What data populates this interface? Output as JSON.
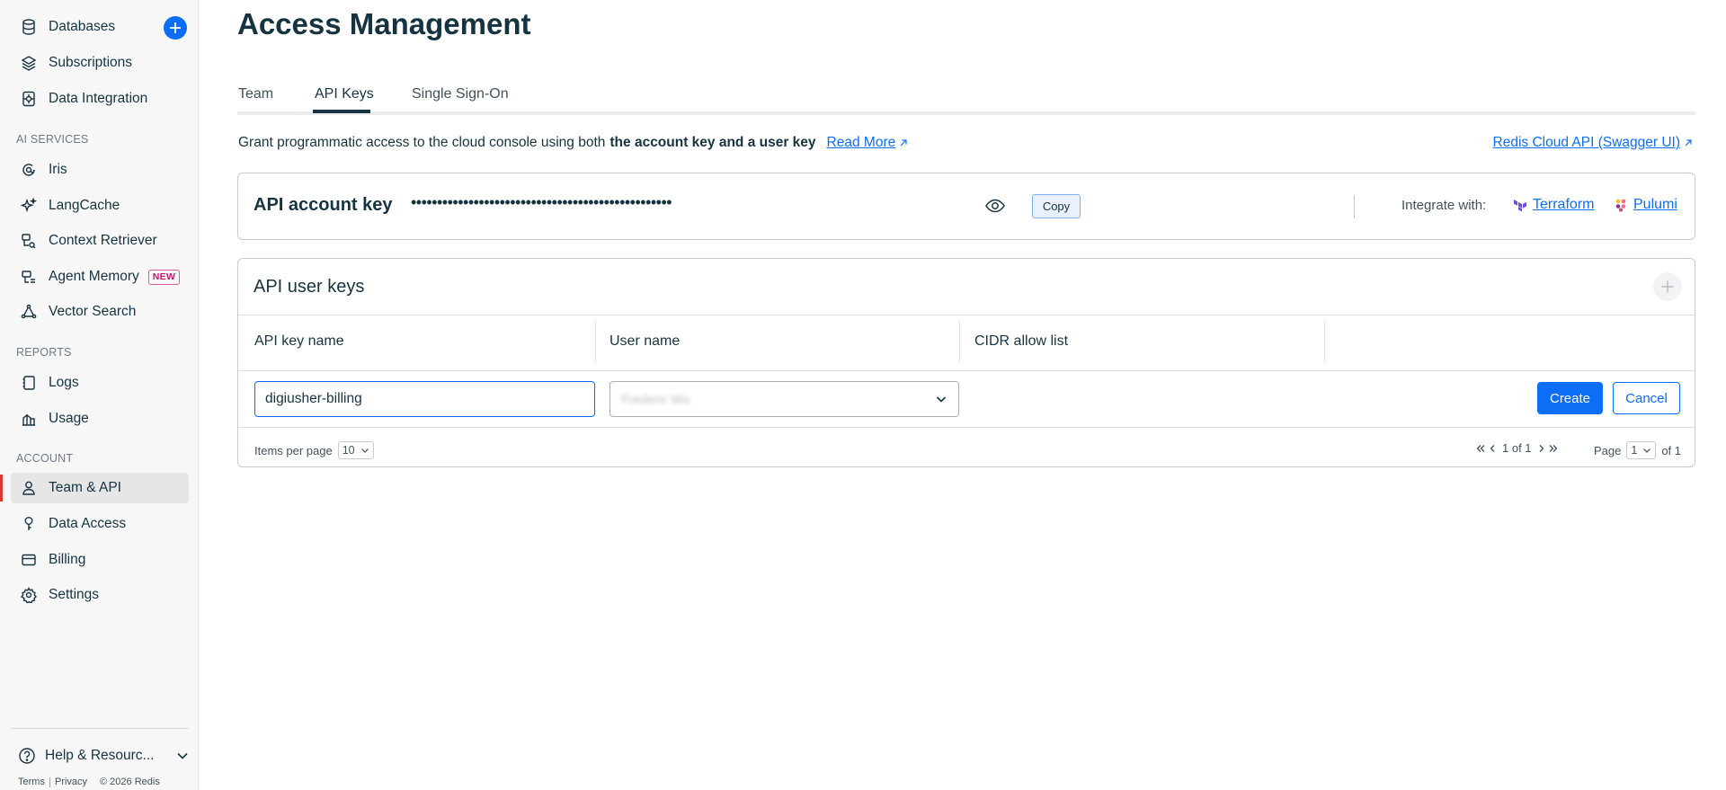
{
  "sidebar": {
    "items": [
      {
        "label": "Databases",
        "icon": "database-icon"
      },
      {
        "label": "Subscriptions",
        "icon": "layers-icon"
      },
      {
        "label": "Data Integration",
        "icon": "data-integration-icon"
      },
      {
        "label": "Iris",
        "icon": "iris-icon"
      },
      {
        "label": "LangCache",
        "icon": "sparkle-icon"
      },
      {
        "label": "Context Retriever",
        "icon": "context-retriever-icon"
      },
      {
        "label": "Agent Memory",
        "icon": "agent-memory-icon",
        "badge": "NEW"
      },
      {
        "label": "Vector Search",
        "icon": "vector-search-icon"
      },
      {
        "label": "Logs",
        "icon": "logs-icon"
      },
      {
        "label": "Usage",
        "icon": "usage-icon"
      },
      {
        "label": "Team & API",
        "icon": "user-icon"
      },
      {
        "label": "Data Access",
        "icon": "key-icon"
      },
      {
        "label": "Billing",
        "icon": "billing-icon"
      },
      {
        "label": "Settings",
        "icon": "gear-icon"
      }
    ],
    "sections": {
      "ai": "AI SERVICES",
      "reports": "REPORTS",
      "account": "ACCOUNT"
    },
    "help": "Help & Resourc...",
    "footer": {
      "terms": "Terms",
      "privacy": "Privacy",
      "copyright": "© 2026 Redis"
    }
  },
  "page": {
    "title": "Access Management"
  },
  "tabs": [
    "Team",
    "API Keys",
    "Single Sign-On"
  ],
  "intro": {
    "text": "Grant programmatic access to the cloud console using both",
    "bold": "the account key and a user key",
    "read_more": "Read More",
    "swagger": "Redis Cloud API (Swagger UI)"
  },
  "account_key": {
    "title": "API account key",
    "masked": "••••••••••••••••••••••••••••••••••••••••••••••••••",
    "copy": "Copy",
    "integrate": "Integrate with:",
    "terraform": "Terraform",
    "pulumi": "Pulumi"
  },
  "user_keys": {
    "title": "API user keys",
    "columns": [
      "API key name",
      "User name",
      "CIDR allow list"
    ],
    "key_name_value": "digiusher-billing",
    "user_select_value": "Frederic Wu",
    "create": "Create",
    "cancel": "Cancel",
    "items_per_page_label": "Items per page",
    "items_per_page": "10",
    "range": "1 of 1",
    "page_label": "Page",
    "page_value": "1",
    "page_of": "of 1"
  },
  "colors": {
    "accent": "#0b6ef5",
    "active_marker": "#dc382d",
    "badge": "#c7156e"
  }
}
